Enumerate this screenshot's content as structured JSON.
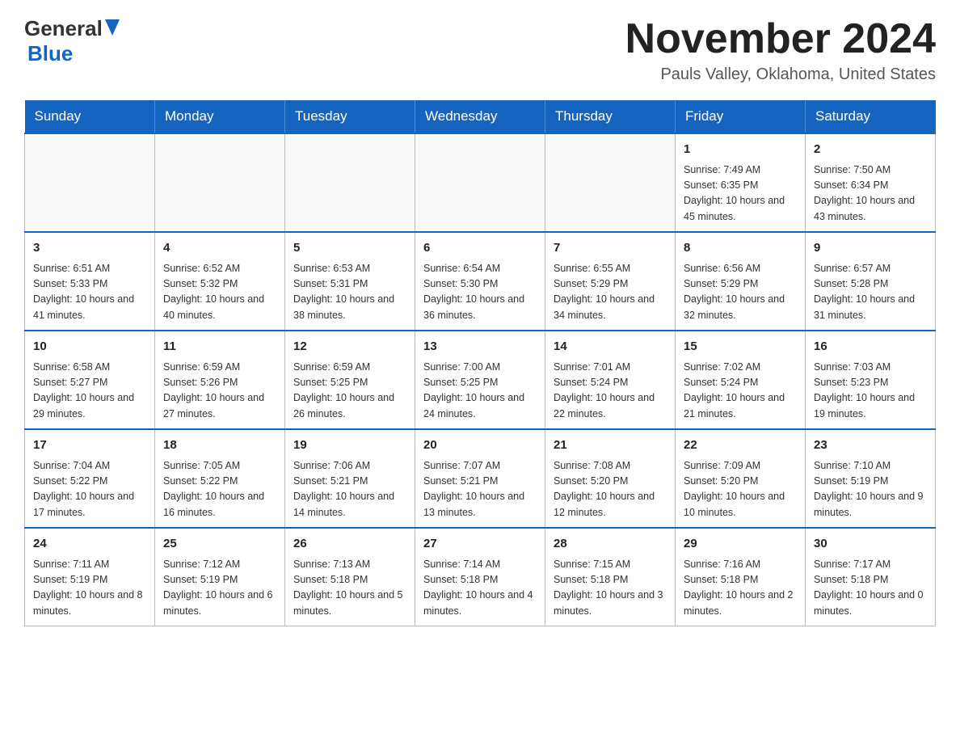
{
  "header": {
    "logo_general": "General",
    "logo_blue": "Blue",
    "month_title": "November 2024",
    "location": "Pauls Valley, Oklahoma, United States"
  },
  "weekdays": [
    "Sunday",
    "Monday",
    "Tuesday",
    "Wednesday",
    "Thursday",
    "Friday",
    "Saturday"
  ],
  "weeks": [
    [
      {
        "day": "",
        "info": ""
      },
      {
        "day": "",
        "info": ""
      },
      {
        "day": "",
        "info": ""
      },
      {
        "day": "",
        "info": ""
      },
      {
        "day": "",
        "info": ""
      },
      {
        "day": "1",
        "info": "Sunrise: 7:49 AM\nSunset: 6:35 PM\nDaylight: 10 hours and 45 minutes."
      },
      {
        "day": "2",
        "info": "Sunrise: 7:50 AM\nSunset: 6:34 PM\nDaylight: 10 hours and 43 minutes."
      }
    ],
    [
      {
        "day": "3",
        "info": "Sunrise: 6:51 AM\nSunset: 5:33 PM\nDaylight: 10 hours and 41 minutes."
      },
      {
        "day": "4",
        "info": "Sunrise: 6:52 AM\nSunset: 5:32 PM\nDaylight: 10 hours and 40 minutes."
      },
      {
        "day": "5",
        "info": "Sunrise: 6:53 AM\nSunset: 5:31 PM\nDaylight: 10 hours and 38 minutes."
      },
      {
        "day": "6",
        "info": "Sunrise: 6:54 AM\nSunset: 5:30 PM\nDaylight: 10 hours and 36 minutes."
      },
      {
        "day": "7",
        "info": "Sunrise: 6:55 AM\nSunset: 5:29 PM\nDaylight: 10 hours and 34 minutes."
      },
      {
        "day": "8",
        "info": "Sunrise: 6:56 AM\nSunset: 5:29 PM\nDaylight: 10 hours and 32 minutes."
      },
      {
        "day": "9",
        "info": "Sunrise: 6:57 AM\nSunset: 5:28 PM\nDaylight: 10 hours and 31 minutes."
      }
    ],
    [
      {
        "day": "10",
        "info": "Sunrise: 6:58 AM\nSunset: 5:27 PM\nDaylight: 10 hours and 29 minutes."
      },
      {
        "day": "11",
        "info": "Sunrise: 6:59 AM\nSunset: 5:26 PM\nDaylight: 10 hours and 27 minutes."
      },
      {
        "day": "12",
        "info": "Sunrise: 6:59 AM\nSunset: 5:25 PM\nDaylight: 10 hours and 26 minutes."
      },
      {
        "day": "13",
        "info": "Sunrise: 7:00 AM\nSunset: 5:25 PM\nDaylight: 10 hours and 24 minutes."
      },
      {
        "day": "14",
        "info": "Sunrise: 7:01 AM\nSunset: 5:24 PM\nDaylight: 10 hours and 22 minutes."
      },
      {
        "day": "15",
        "info": "Sunrise: 7:02 AM\nSunset: 5:24 PM\nDaylight: 10 hours and 21 minutes."
      },
      {
        "day": "16",
        "info": "Sunrise: 7:03 AM\nSunset: 5:23 PM\nDaylight: 10 hours and 19 minutes."
      }
    ],
    [
      {
        "day": "17",
        "info": "Sunrise: 7:04 AM\nSunset: 5:22 PM\nDaylight: 10 hours and 17 minutes."
      },
      {
        "day": "18",
        "info": "Sunrise: 7:05 AM\nSunset: 5:22 PM\nDaylight: 10 hours and 16 minutes."
      },
      {
        "day": "19",
        "info": "Sunrise: 7:06 AM\nSunset: 5:21 PM\nDaylight: 10 hours and 14 minutes."
      },
      {
        "day": "20",
        "info": "Sunrise: 7:07 AM\nSunset: 5:21 PM\nDaylight: 10 hours and 13 minutes."
      },
      {
        "day": "21",
        "info": "Sunrise: 7:08 AM\nSunset: 5:20 PM\nDaylight: 10 hours and 12 minutes."
      },
      {
        "day": "22",
        "info": "Sunrise: 7:09 AM\nSunset: 5:20 PM\nDaylight: 10 hours and 10 minutes."
      },
      {
        "day": "23",
        "info": "Sunrise: 7:10 AM\nSunset: 5:19 PM\nDaylight: 10 hours and 9 minutes."
      }
    ],
    [
      {
        "day": "24",
        "info": "Sunrise: 7:11 AM\nSunset: 5:19 PM\nDaylight: 10 hours and 8 minutes."
      },
      {
        "day": "25",
        "info": "Sunrise: 7:12 AM\nSunset: 5:19 PM\nDaylight: 10 hours and 6 minutes."
      },
      {
        "day": "26",
        "info": "Sunrise: 7:13 AM\nSunset: 5:18 PM\nDaylight: 10 hours and 5 minutes."
      },
      {
        "day": "27",
        "info": "Sunrise: 7:14 AM\nSunset: 5:18 PM\nDaylight: 10 hours and 4 minutes."
      },
      {
        "day": "28",
        "info": "Sunrise: 7:15 AM\nSunset: 5:18 PM\nDaylight: 10 hours and 3 minutes."
      },
      {
        "day": "29",
        "info": "Sunrise: 7:16 AM\nSunset: 5:18 PM\nDaylight: 10 hours and 2 minutes."
      },
      {
        "day": "30",
        "info": "Sunrise: 7:17 AM\nSunset: 5:18 PM\nDaylight: 10 hours and 0 minutes."
      }
    ]
  ]
}
